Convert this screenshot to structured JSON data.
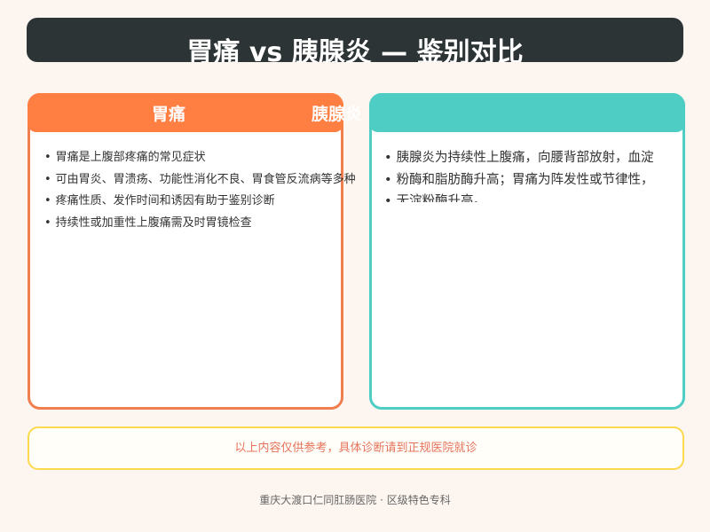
{
  "header": {
    "title": "胃痛 vs 胰腺炎 — 鉴别对比",
    "bg_color": "#2d3436"
  },
  "left_card": {
    "title": "胃痛",
    "overlap_title": "胰腺炎",
    "accent_color": "#ff7f42",
    "items": [
      "胃痛是上腹部疼痛的常见症状",
      "可由胃炎、胃溃疡、功能性消化不良、胃食管反流病等多种",
      "疼痛性质、发作时间和诱因有助于鉴别诊断",
      "持续性或加重性上腹痛需及时胃镜检查"
    ]
  },
  "right_card": {
    "accent_color": "#4ecdc4",
    "items": [
      "胰腺炎为持续性上腹痛，向腰背部放射，血淀",
      "粉酶和脂肪酶升高；胃痛为阵发性或节律性，",
      "无淀粉酶升高。"
    ]
  },
  "disclaimer": {
    "text": "以上内容仅供参考，具体诊断请到正规医院就诊",
    "border_color": "#fdd94e"
  },
  "footer": {
    "text": "重庆大渡口仁同肛肠医院 · 区级特色专科"
  }
}
